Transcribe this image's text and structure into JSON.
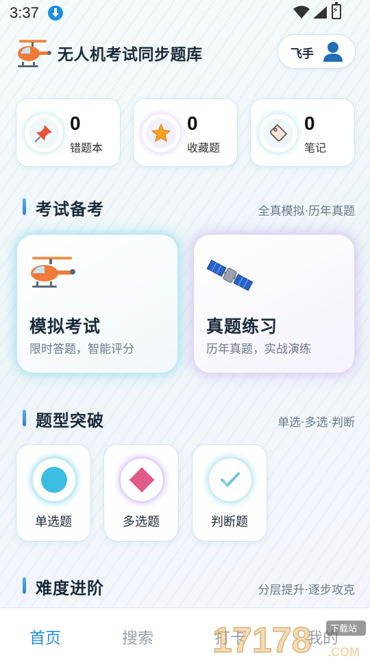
{
  "status_bar": {
    "time": "3:37"
  },
  "header": {
    "app_title": "无人机考试同步题库",
    "user_name": "飞手"
  },
  "stats": [
    {
      "value": "0",
      "label": "错题本",
      "icon": "pushpin-icon"
    },
    {
      "value": "0",
      "label": "收藏题",
      "icon": "star-icon"
    },
    {
      "value": "0",
      "label": "笔记",
      "icon": "note-tag-icon"
    }
  ],
  "sections": {
    "exam": {
      "title": "考试备考",
      "subtitle": "全真模拟·历年真题"
    },
    "types": {
      "title": "题型突破",
      "subtitle": "单选·多选·判断"
    },
    "difficulty": {
      "title": "难度进阶",
      "subtitle": "分层提升·逐步攻克"
    }
  },
  "exam_cards": [
    {
      "title": "模拟考试",
      "desc": "限时答题，智能评分",
      "icon": "helicopter-icon"
    },
    {
      "title": "真题练习",
      "desc": "历年真题，实战演练",
      "icon": "satellite-icon"
    }
  ],
  "type_cards": [
    {
      "label": "单选题",
      "icon": "single-choice-circle-icon"
    },
    {
      "label": "多选题",
      "icon": "multi-choice-diamond-icon"
    },
    {
      "label": "判断题",
      "icon": "true-false-check-icon"
    }
  ],
  "nav": [
    {
      "label": "首页",
      "active": true
    },
    {
      "label": "搜索",
      "active": false
    },
    {
      "label": "打卡",
      "active": false
    },
    {
      "label": "我的",
      "active": false
    }
  ],
  "watermark": {
    "text": "17178",
    "domain": ".COM",
    "badge": "下载站"
  },
  "colors": {
    "accent": "#1e8fe0",
    "cyan_glow": "#50c8e1",
    "purple_glow": "#af8cf0",
    "orange": "#f07a3a"
  }
}
